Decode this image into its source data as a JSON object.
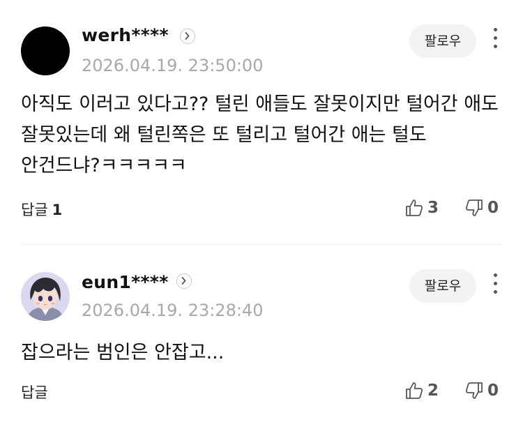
{
  "comments": [
    {
      "username": "werh****",
      "timestamp": "2026.04.19. 23:50:00",
      "follow_label": "팔로우",
      "body": "아직도 이러고 있다고?? 털린 애들도 잘못이지만 털어간 애도 잘못있는데 왜 털린쪽은 또 털리고 털어간 애는 털도 안건드냐?ㅋㅋㅋㅋㅋ",
      "reply_label": "답글",
      "reply_count": "1",
      "likes": "3",
      "dislikes": "0"
    },
    {
      "username": "eun1****",
      "timestamp": "2026.04.19. 23:28:40",
      "follow_label": "팔로우",
      "body": "잡으라는 범인은 안잡고...",
      "reply_label": "답글",
      "likes": "2",
      "dislikes": "0"
    }
  ]
}
